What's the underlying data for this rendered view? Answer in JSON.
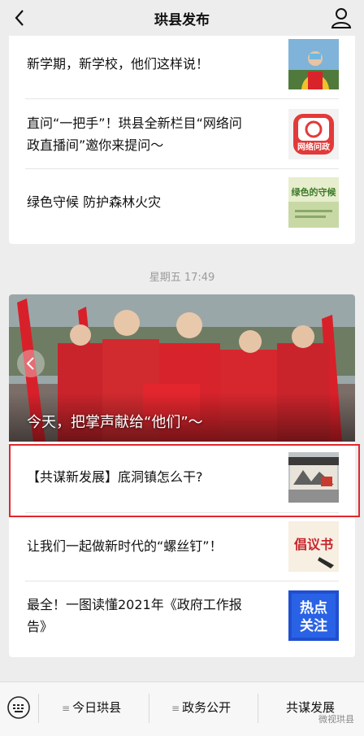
{
  "nav": {
    "title": "珙县发布"
  },
  "top_articles": [
    {
      "title": "新学期，新学校，他们这样说！"
    },
    {
      "title_line1": "直问“一把手”！珙县全新栏目“网络问",
      "title_line2": "政直播间”邀你来提问～",
      "thumb_text": "网络问政"
    },
    {
      "title": "绿色守候 防护森林火灾",
      "thumb_text": "绿色的守候"
    }
  ],
  "time_stamp": "星期五 17:49",
  "hero": {
    "caption": "今天，把掌声献给“他们”～"
  },
  "articles": [
    {
      "title": "【共谋新发展】底洞镇怎么干?"
    },
    {
      "title": "让我们一起做新时代的“螺丝钉”！",
      "thumb_text": "倡议书"
    },
    {
      "title_line1": "最全！一图读懂2021年《政府工作报",
      "title_line2": "告》",
      "thumb_text_1": "热点",
      "thumb_text_2": "关注"
    }
  ],
  "tabbar": {
    "tabs": [
      "今日珙县",
      "政务公开",
      "共谋发展"
    ]
  },
  "watermark": "微视珙县"
}
